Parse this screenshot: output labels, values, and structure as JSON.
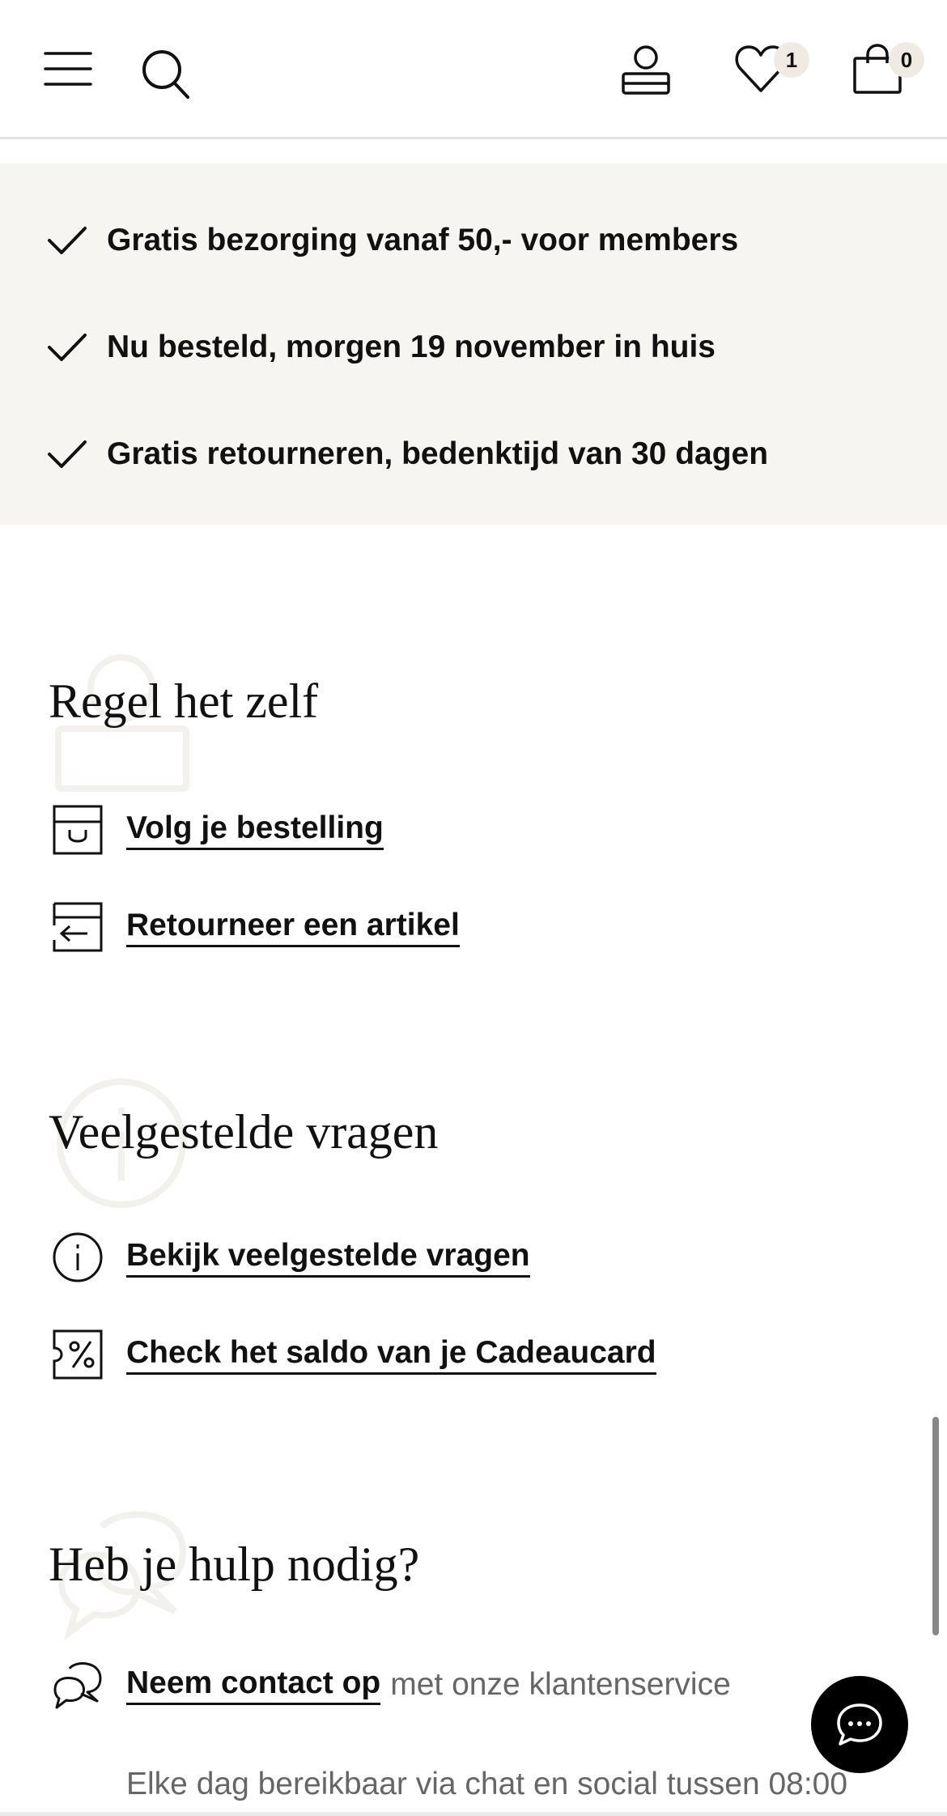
{
  "header": {
    "menu_icon": "hamburger-menu-icon",
    "search_icon": "search-icon",
    "account_icon": "user-account-icon",
    "wishlist_icon": "heart-icon",
    "wishlist_count": "1",
    "cart_icon": "shopping-bag-icon",
    "cart_count": "0"
  },
  "usps": [
    {
      "icon": "check-icon",
      "text": "Gratis bezorging vanaf 50,- voor members"
    },
    {
      "icon": "check-icon",
      "text": "Nu besteld, morgen 19 november in huis"
    },
    {
      "icon": "check-icon",
      "text": "Gratis retourneren, bedenktijd van 30 dagen"
    }
  ],
  "self_service": {
    "title": "Regel het zelf",
    "watermark_icon": "user-icon",
    "links": [
      {
        "icon": "package-icon",
        "label": "Volg je bestelling"
      },
      {
        "icon": "return-box-icon",
        "label": "Retourneer een artikel"
      }
    ]
  },
  "faq": {
    "title": "Veelgestelde vragen",
    "watermark_icon": "info-icon",
    "links": [
      {
        "icon": "info-icon",
        "label": "Bekijk veelgestelde vragen"
      },
      {
        "icon": "gift-card-percent-icon",
        "label": "Check het saldo van je Cadeaucard"
      }
    ]
  },
  "help": {
    "title": "Heb je hulp nodig?",
    "watermark_icon": "chat-bubbles-icon",
    "contact_link": "Neem contact op",
    "contact_suffix": "met onze klantenservice",
    "availability": "Elke dag bereikbaar via chat en social tussen 08:00"
  },
  "chat_button_icon": "chat-icon",
  "colors": {
    "usp_background": "#f6f5f1",
    "badge_background": "#efebe3",
    "text": "#111111",
    "muted_text": "#666666",
    "chat_button": "#000000"
  }
}
